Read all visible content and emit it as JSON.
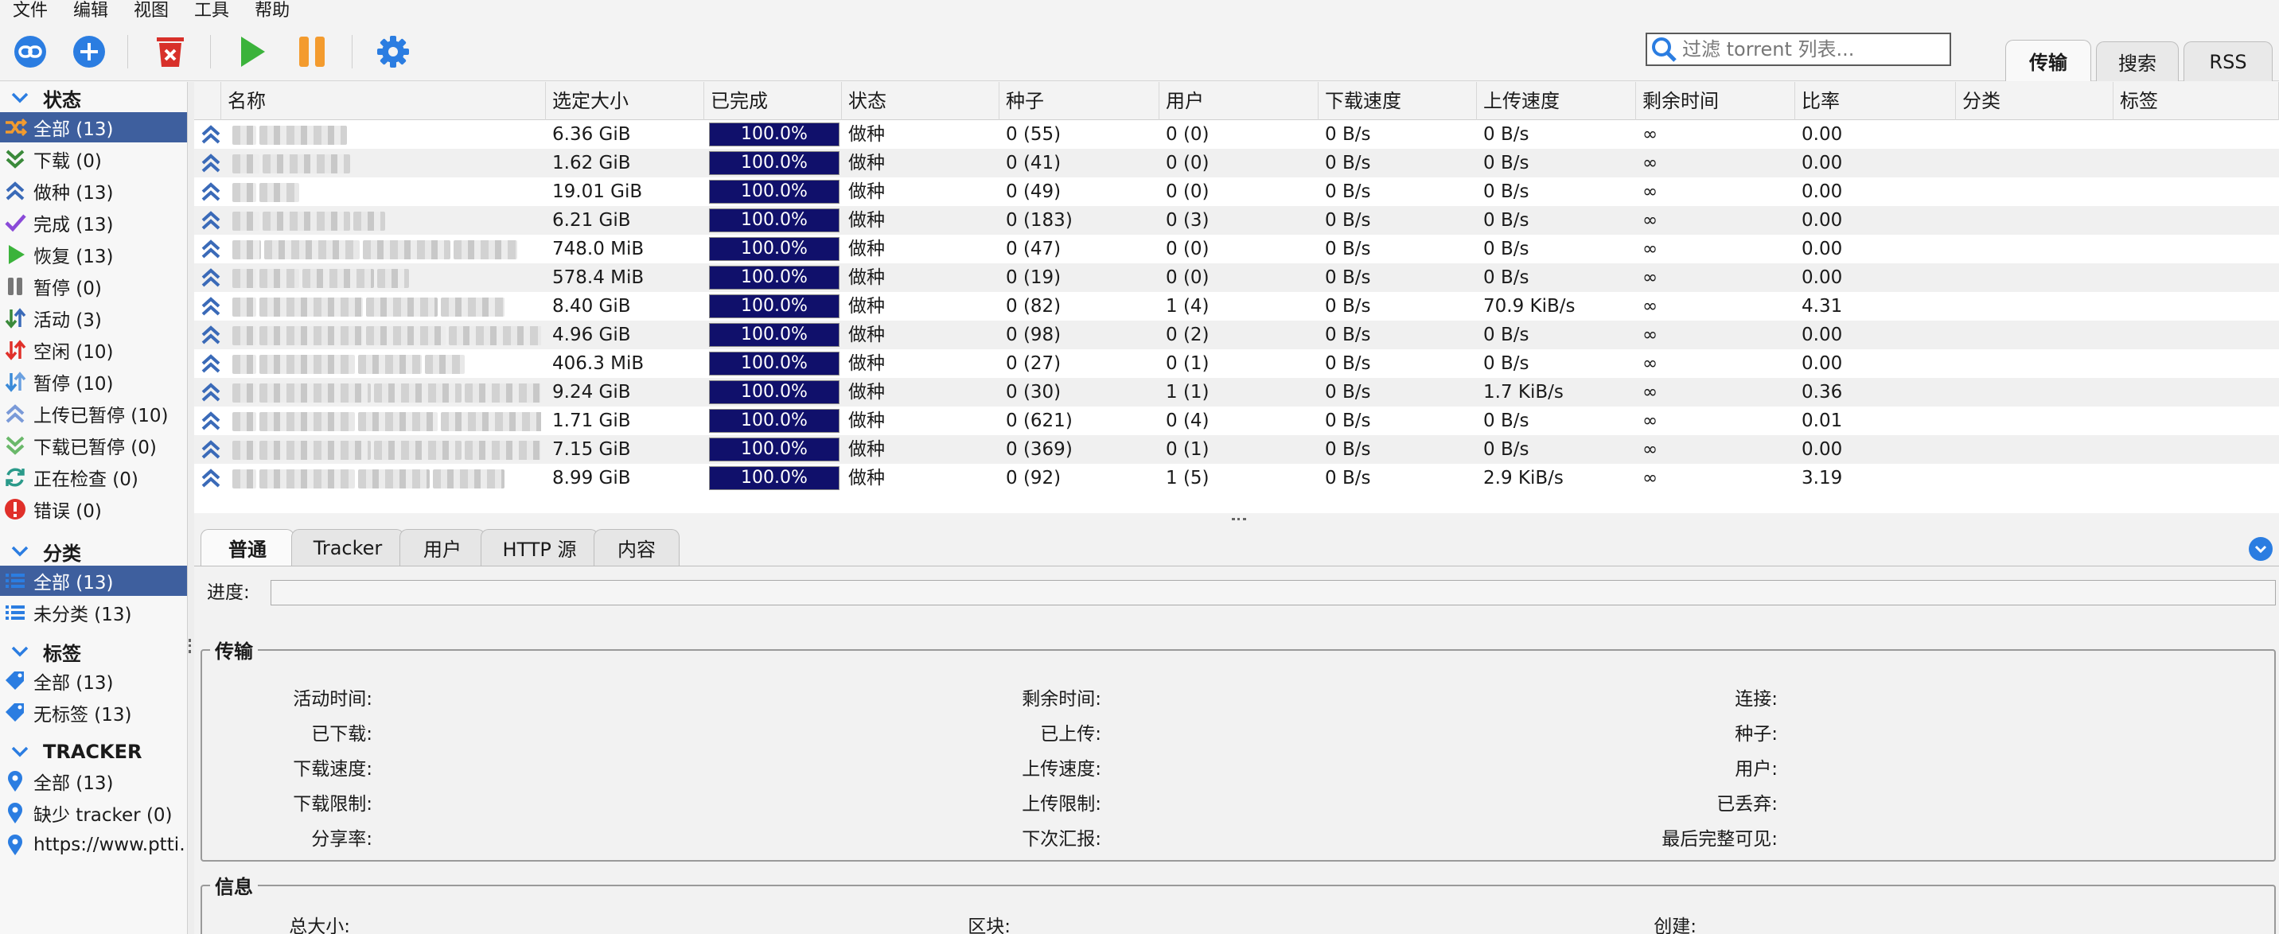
{
  "menu": [
    "文件",
    "编辑",
    "视图",
    "工具",
    "帮助"
  ],
  "filter_placeholder": "过滤 torrent 列表...",
  "right_tabs": [
    "传输",
    "搜索",
    "RSS"
  ],
  "sidebar": {
    "status_header": "状态",
    "status_items": [
      "全部 (13)",
      "下载 (0)",
      "做种 (13)",
      "完成 (13)",
      "恢复 (13)",
      "暂停 (0)",
      "活动 (3)",
      "空闲 (10)",
      "暂停 (10)",
      "上传已暂停 (10)",
      "下载已暂停 (0)",
      "正在检查 (0)",
      "错误 (0)"
    ],
    "category_header": "分类",
    "category_items": [
      "全部 (13)",
      "未分类 (13)"
    ],
    "tag_header": "标签",
    "tag_items": [
      "全部 (13)",
      "无标签 (13)"
    ],
    "tracker_header": "TRACKER",
    "tracker_items": [
      "全部 (13)",
      "缺少 tracker (0)",
      "https://www.ptti…"
    ]
  },
  "columns": [
    "名称",
    "选定大小",
    "已完成",
    "状态",
    "种子",
    "用户",
    "下载速度",
    "上传速度",
    "剩余时间",
    "比率",
    "分类",
    "标签"
  ],
  "rows": [
    {
      "size": "6.36 GiB",
      "done": "100.0%",
      "status": "做种",
      "seeds": "0 (55)",
      "peers": "0 (0)",
      "dl": "0 B/s",
      "ul": "0 B/s",
      "eta": "∞",
      "ratio": "0.00"
    },
    {
      "size": "1.62 GiB",
      "done": "100.0%",
      "status": "做种",
      "seeds": "0 (41)",
      "peers": "0 (0)",
      "dl": "0 B/s",
      "ul": "0 B/s",
      "eta": "∞",
      "ratio": "0.00"
    },
    {
      "size": "19.01 GiB",
      "done": "100.0%",
      "status": "做种",
      "seeds": "0 (49)",
      "peers": "0 (0)",
      "dl": "0 B/s",
      "ul": "0 B/s",
      "eta": "∞",
      "ratio": "0.00"
    },
    {
      "size": "6.21 GiB",
      "done": "100.0%",
      "status": "做种",
      "seeds": "0 (183)",
      "peers": "0 (3)",
      "dl": "0 B/s",
      "ul": "0 B/s",
      "eta": "∞",
      "ratio": "0.00"
    },
    {
      "size": "748.0 MiB",
      "done": "100.0%",
      "status": "做种",
      "seeds": "0 (47)",
      "peers": "0 (0)",
      "dl": "0 B/s",
      "ul": "0 B/s",
      "eta": "∞",
      "ratio": "0.00"
    },
    {
      "size": "578.4 MiB",
      "done": "100.0%",
      "status": "做种",
      "seeds": "0 (19)",
      "peers": "0 (0)",
      "dl": "0 B/s",
      "ul": "0 B/s",
      "eta": "∞",
      "ratio": "0.00"
    },
    {
      "size": "8.40 GiB",
      "done": "100.0%",
      "status": "做种",
      "seeds": "0 (82)",
      "peers": "1 (4)",
      "dl": "0 B/s",
      "ul": "70.9 KiB/s",
      "eta": "∞",
      "ratio": "4.31"
    },
    {
      "size": "4.96 GiB",
      "done": "100.0%",
      "status": "做种",
      "seeds": "0 (98)",
      "peers": "0 (2)",
      "dl": "0 B/s",
      "ul": "0 B/s",
      "eta": "∞",
      "ratio": "0.00"
    },
    {
      "size": "406.3 MiB",
      "done": "100.0%",
      "status": "做种",
      "seeds": "0 (27)",
      "peers": "0 (1)",
      "dl": "0 B/s",
      "ul": "0 B/s",
      "eta": "∞",
      "ratio": "0.00"
    },
    {
      "size": "9.24 GiB",
      "done": "100.0%",
      "status": "做种",
      "seeds": "0 (30)",
      "peers": "1 (1)",
      "dl": "0 B/s",
      "ul": "1.7 KiB/s",
      "eta": "∞",
      "ratio": "0.36"
    },
    {
      "size": "1.71 GiB",
      "done": "100.0%",
      "status": "做种",
      "seeds": "0 (621)",
      "peers": "0 (4)",
      "dl": "0 B/s",
      "ul": "0 B/s",
      "eta": "∞",
      "ratio": "0.01"
    },
    {
      "size": "7.15 GiB",
      "done": "100.0%",
      "status": "做种",
      "seeds": "0 (369)",
      "peers": "0 (1)",
      "dl": "0 B/s",
      "ul": "0 B/s",
      "eta": "∞",
      "ratio": "0.00"
    },
    {
      "size": "8.99 GiB",
      "done": "100.0%",
      "status": "做种",
      "seeds": "0 (92)",
      "peers": "1 (5)",
      "dl": "0 B/s",
      "ul": "2.9 KiB/s",
      "eta": "∞",
      "ratio": "3.19"
    }
  ],
  "props": {
    "tabs": [
      "普通",
      "Tracker",
      "用户",
      "HTTP 源",
      "内容"
    ],
    "progress_label": "进度:",
    "transfer_legend": "传输",
    "transfer_col1": [
      "活动时间:",
      "已下载:",
      "下载速度:",
      "下载限制:",
      "分享率:"
    ],
    "transfer_col2": [
      "剩余时间:",
      "已上传:",
      "上传速度:",
      "上传限制:",
      "下次汇报:"
    ],
    "transfer_col3": [
      "连接:",
      "种子:",
      "用户:",
      "已丢弃:",
      "最后完整可见:"
    ],
    "info_legend": "信息",
    "info_labels": [
      "总大小:",
      "区块:",
      "创建:"
    ]
  },
  "colors": {
    "selection": "#3e5f9e",
    "progress_fill": "#10106b",
    "accent_blue": "#2b7de1"
  }
}
